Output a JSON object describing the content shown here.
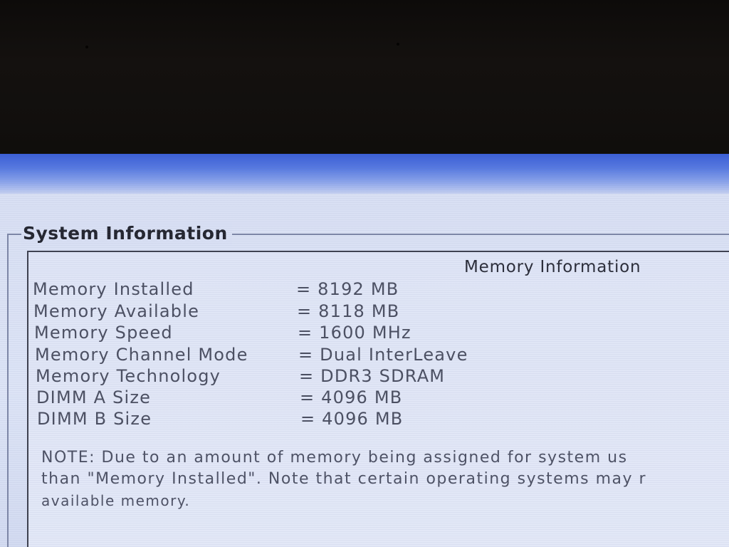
{
  "group": {
    "title": "System Information"
  },
  "panel": {
    "heading": "Memory Information"
  },
  "memory_rows": [
    {
      "label": "Memory Installed",
      "value": "= 8192 MB"
    },
    {
      "label": "Memory Available",
      "value": "= 8118 MB"
    },
    {
      "label": "Memory Speed",
      "value": "= 1600 MHz"
    },
    {
      "label": "Memory Channel Mode",
      "value": "= Dual InterLeave"
    },
    {
      "label": "Memory Technology",
      "value": "= DDR3 SDRAM"
    },
    {
      "label": "DIMM A Size",
      "value": "= 4096 MB"
    },
    {
      "label": "DIMM B Size",
      "value": "= 4096 MB"
    }
  ],
  "note": {
    "line1": "NOTE: Due to an amount of memory being assigned for system us",
    "line2": "than \"Memory Installed\". Note that certain operating systems may r",
    "line3": "available memory."
  },
  "colors": {
    "title_bar_blue": "#3a5ed6",
    "screen_background": "#dde4f6",
    "text": "#4b4f61"
  }
}
